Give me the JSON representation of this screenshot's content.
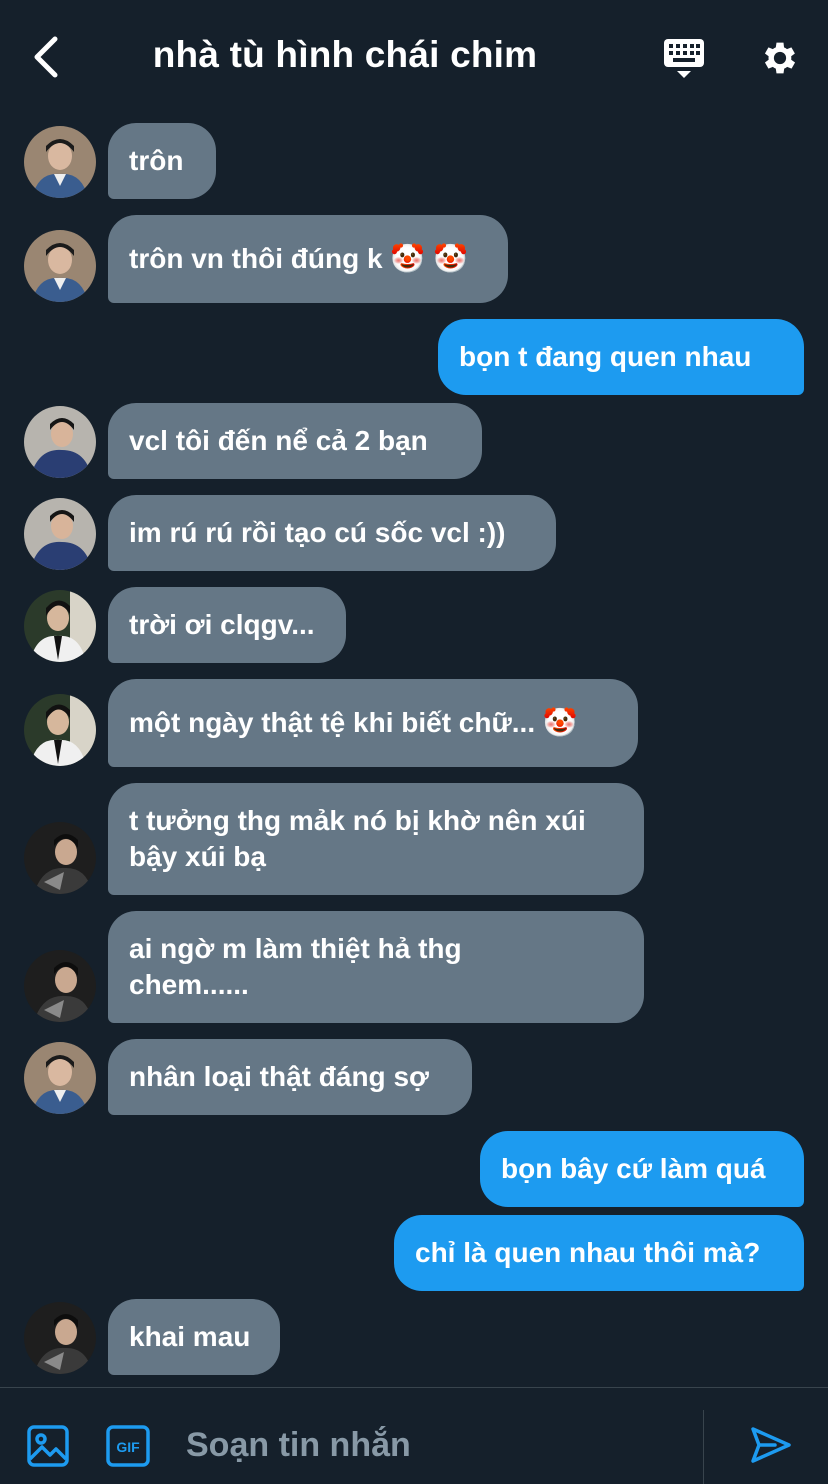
{
  "header": {
    "title": "nhà tù hình chái chim",
    "back_icon": "chevron-left-icon",
    "keyboard_icon": "keyboard-icon",
    "settings_icon": "gear-icon"
  },
  "colors": {
    "background": "#15202b",
    "incoming_bubble": "#657786",
    "outgoing_bubble": "#1d9bf0",
    "muted_text": "#8899a6"
  },
  "messages": [
    {
      "dir": "in",
      "sender": "a",
      "text": "trôn"
    },
    {
      "dir": "in",
      "sender": "a",
      "text": "trôn vn thôi đúng k 🤡 🤡"
    },
    {
      "dir": "out",
      "text": "bọn t đang quen nhau"
    },
    {
      "dir": "in",
      "sender": "b",
      "text": "vcl tôi đến nể cả 2 bạn"
    },
    {
      "dir": "in",
      "sender": "b",
      "text": "im rú rú rồi tạo cú sốc vcl :))"
    },
    {
      "dir": "in",
      "sender": "c",
      "text": "trời ơi clqgv..."
    },
    {
      "dir": "in",
      "sender": "c",
      "text": "một ngày thật tệ khi biết chữ... 🤡"
    },
    {
      "dir": "in",
      "sender": "d",
      "text": "t tưởng thg mảk nó bị khờ nên xúi bậy xúi bạ"
    },
    {
      "dir": "in",
      "sender": "d",
      "text": "ai ngờ m làm thiệt hả thg chem......"
    },
    {
      "dir": "in",
      "sender": "a",
      "text": "nhân loại thật đáng sợ"
    },
    {
      "dir": "out",
      "text": "bọn bây cứ làm quá"
    },
    {
      "dir": "out",
      "text": "chỉ là quen nhau thôi mà?"
    },
    {
      "dir": "in",
      "sender": "d",
      "text": "khai mau"
    }
  ],
  "composer": {
    "placeholder": "Soạn tin nhắn",
    "image_icon": "image-icon",
    "gif_icon": "gif-icon",
    "gif_label": "GIF",
    "send_icon": "send-icon"
  }
}
